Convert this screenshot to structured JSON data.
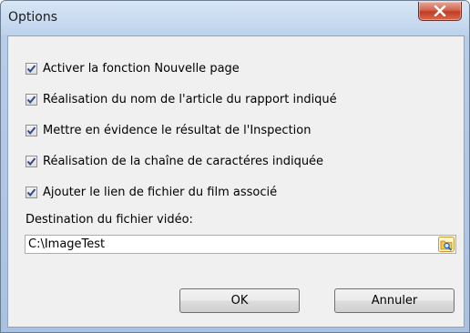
{
  "window": {
    "title": "Options"
  },
  "options": [
    {
      "label": "Activer la fonction Nouvelle page",
      "checked": true
    },
    {
      "label": "Réalisation du nom de l'article du rapport indiqué",
      "checked": true
    },
    {
      "label": "Mettre en évidence le résultat de l'Inspection",
      "checked": true
    },
    {
      "label": "Réalisation de la chaîne de caractéres indiquée",
      "checked": true
    },
    {
      "label": "Ajouter le lien de fichier du film associé",
      "checked": true
    }
  ],
  "destination": {
    "label": "Destination du fichier vidéo:",
    "value": "C:\\ImageTest"
  },
  "buttons": {
    "ok": "OK",
    "cancel": "Annuler"
  },
  "icons": {
    "close": "close-icon",
    "checkmark": "checkmark-icon",
    "browse": "folder-search-icon"
  },
  "colors": {
    "close_button": "#c13d23",
    "check": "#2c4a8a"
  }
}
